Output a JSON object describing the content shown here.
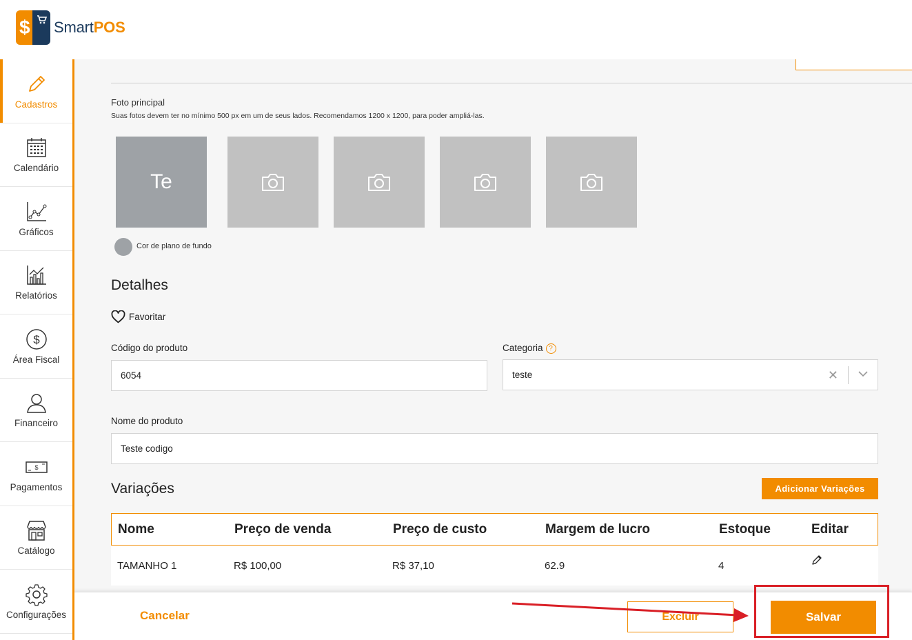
{
  "app": {
    "logo_text_1": "Smart",
    "logo_text_2": "POS",
    "logo_symbol": "$"
  },
  "sidebar": {
    "items": [
      {
        "label": "Cadastros",
        "icon": "pencil-icon",
        "active": true
      },
      {
        "label": "Calendário",
        "icon": "calendar-icon"
      },
      {
        "label": "Gráficos",
        "icon": "line-chart-icon"
      },
      {
        "label": "Relatórios",
        "icon": "bar-chart-icon"
      },
      {
        "label": "Área Fiscal",
        "icon": "dollar-circle-icon"
      },
      {
        "label": "Financeiro",
        "icon": "person-icon"
      },
      {
        "label": "Pagamentos",
        "icon": "banknote-icon"
      },
      {
        "label": "Catálogo",
        "icon": "store-icon"
      },
      {
        "label": "Configurações",
        "icon": "gear-icon"
      }
    ]
  },
  "photos": {
    "label": "Foto principal",
    "hint": "Suas fotos devem ter no mínimo 500 px em um de seus lados. Recomendamos 1200 x 1200, para poder ampliá-las.",
    "main_initials": "Te",
    "bg_color_label": "Cor de plano de fundo",
    "bg_color": "#9ea2a6"
  },
  "details": {
    "title": "Detalhes",
    "favorite_label": "Favoritar",
    "code_label": "Código do produto",
    "code_value": "6054",
    "category_label": "Categoria",
    "category_value": "teste",
    "help_symbol": "?",
    "clear_symbol": "✕",
    "name_label": "Nome do produto",
    "name_value": "Teste codigo"
  },
  "variations": {
    "title": "Variações",
    "add_button": "Adicionar Variações",
    "columns": [
      "Nome",
      "Preço de venda",
      "Preço de custo",
      "Margem de lucro",
      "Estoque",
      "Editar"
    ],
    "rows": [
      {
        "nome": "TAMANHO 1",
        "preco_venda": "R$ 100,00",
        "preco_custo": "R$ 37,10",
        "margem": "62.9",
        "estoque": "4"
      }
    ]
  },
  "footer": {
    "cancel": "Cancelar",
    "delete": "Excluir",
    "save": "Salvar"
  },
  "colors": {
    "accent": "#f28c00",
    "brand_dark": "#1b3a5c",
    "annotation": "#d91f26"
  }
}
